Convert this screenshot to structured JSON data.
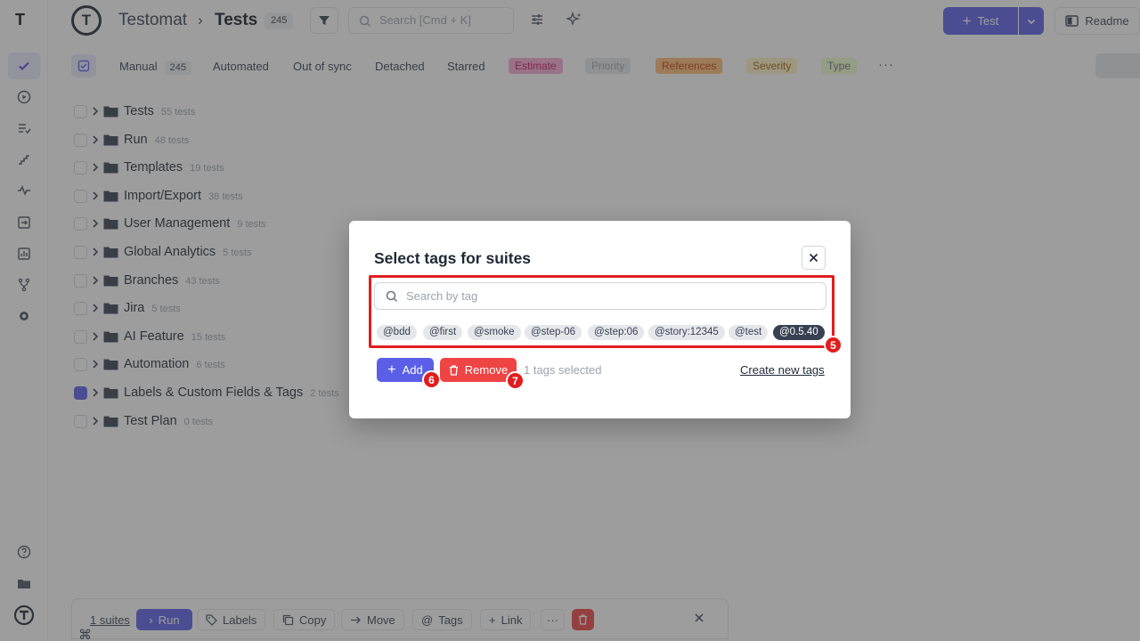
{
  "rail": {
    "logo_text": "T",
    "icons": [
      "tests-check-icon",
      "runs-play-icon",
      "plans-list-icon",
      "steps-icon",
      "pulse-icon",
      "import-icon",
      "analytics-icon",
      "branches-icon",
      "settings-gear-icon"
    ],
    "bottom_icons": [
      "help-icon",
      "projects-folder-icon",
      "testomat-logo-icon"
    ]
  },
  "header": {
    "logo_text": "T",
    "project": "Testomat",
    "separator": "›",
    "page": "Tests",
    "count": "245",
    "search_placeholder": "Search [Cmd + K]",
    "add_test_label": "Test",
    "readme_label": "Readme"
  },
  "tabs": {
    "manual_label": "Manual",
    "manual_count": "245",
    "automated": "Automated",
    "out_of_sync": "Out of sync",
    "detached": "Detached",
    "starred": "Starred",
    "chips": [
      {
        "label": "Estimate",
        "bg": "#f9a8d4",
        "fg": "#be185d"
      },
      {
        "label": "Priority",
        "bg": "#e5e7eb",
        "fg": "#9ca3af"
      },
      {
        "label": "References",
        "bg": "#fdba74",
        "fg": "#c2410c"
      },
      {
        "label": "Severity",
        "bg": "#fef3c7",
        "fg": "#a16207"
      },
      {
        "label": "Type",
        "bg": "#ecfccb",
        "fg": "#6b7280"
      }
    ],
    "more": "···"
  },
  "tree": [
    {
      "name": "Tests",
      "count": "55 tests",
      "checked": false
    },
    {
      "name": "Run",
      "count": "48 tests",
      "checked": false
    },
    {
      "name": "Templates",
      "count": "19 tests",
      "checked": false
    },
    {
      "name": "Import/Export",
      "count": "38 tests",
      "checked": false
    },
    {
      "name": "User Management",
      "count": "9 tests",
      "checked": false
    },
    {
      "name": "Global Analytics",
      "count": "5 tests",
      "checked": false
    },
    {
      "name": "Branches",
      "count": "43 tests",
      "checked": false
    },
    {
      "name": "Jira",
      "count": "5 tests",
      "checked": false
    },
    {
      "name": "AI Feature",
      "count": "15 tests",
      "checked": false
    },
    {
      "name": "Automation",
      "count": "6 tests",
      "checked": false
    },
    {
      "name": "Labels & Custom Fields & Tags",
      "count": "2 tests",
      "checked": true
    },
    {
      "name": "Test Plan",
      "count": "0 tests",
      "checked": false
    }
  ],
  "bottom_bar": {
    "suites": "1 suites",
    "run": "Run",
    "labels": "Labels",
    "copy": "Copy",
    "move": "Move",
    "tags": "Tags",
    "link": "Link",
    "more": "···",
    "cmd_glyph": "⌘"
  },
  "modal": {
    "title": "Select tags for suites",
    "search_placeholder": "Search by tag",
    "tags": [
      {
        "label": "@bdd",
        "selected": false
      },
      {
        "label": "@first",
        "selected": false
      },
      {
        "label": "@smoke",
        "selected": false
      },
      {
        "label": "@step-06",
        "selected": false
      },
      {
        "label": "@step:06",
        "selected": false
      },
      {
        "label": "@story:12345",
        "selected": false
      },
      {
        "label": "@test",
        "selected": false
      },
      {
        "label": "@0.5.40",
        "selected": true
      }
    ],
    "add_label": "Add",
    "remove_label": "Remove",
    "selected_text": "1 tags selected",
    "create_link": "Create new tags",
    "badges": {
      "highlight": "5",
      "add": "6",
      "remove": "7"
    }
  },
  "colors": {
    "accent": "#5b5fe8",
    "danger": "#ef4444",
    "annotation": "#e11d1d"
  }
}
